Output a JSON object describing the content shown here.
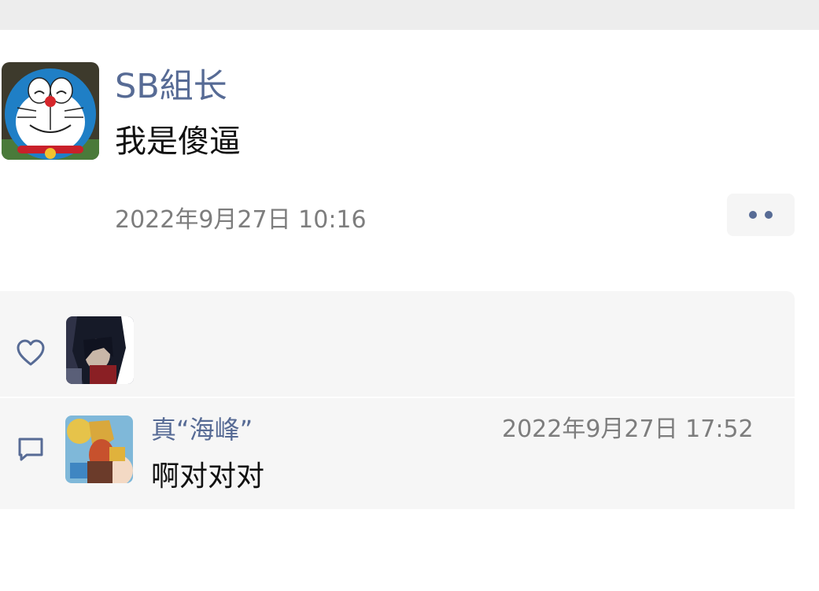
{
  "post": {
    "author": "SB組长",
    "text": "我是傻逼",
    "time": "2022年9月27日 10:16",
    "avatar": "doraemon-avatar"
  },
  "more_button": {
    "icon": "two-dots-icon"
  },
  "likes": {
    "icon": "heart-icon",
    "avatars": [
      "dark-haired-character-avatar"
    ]
  },
  "comments": {
    "icon": "comment-bubble-icon",
    "items": [
      {
        "name": "真“海峰”",
        "time": "2022年9月27日 17:52",
        "text": "啊对对对",
        "avatar": "golden-armor-character-avatar"
      }
    ]
  },
  "colors": {
    "link": "#576b95",
    "text": "#111111",
    "meta": "#7d7d7d",
    "panel": "#f6f6f6",
    "topbar": "#ededed"
  }
}
